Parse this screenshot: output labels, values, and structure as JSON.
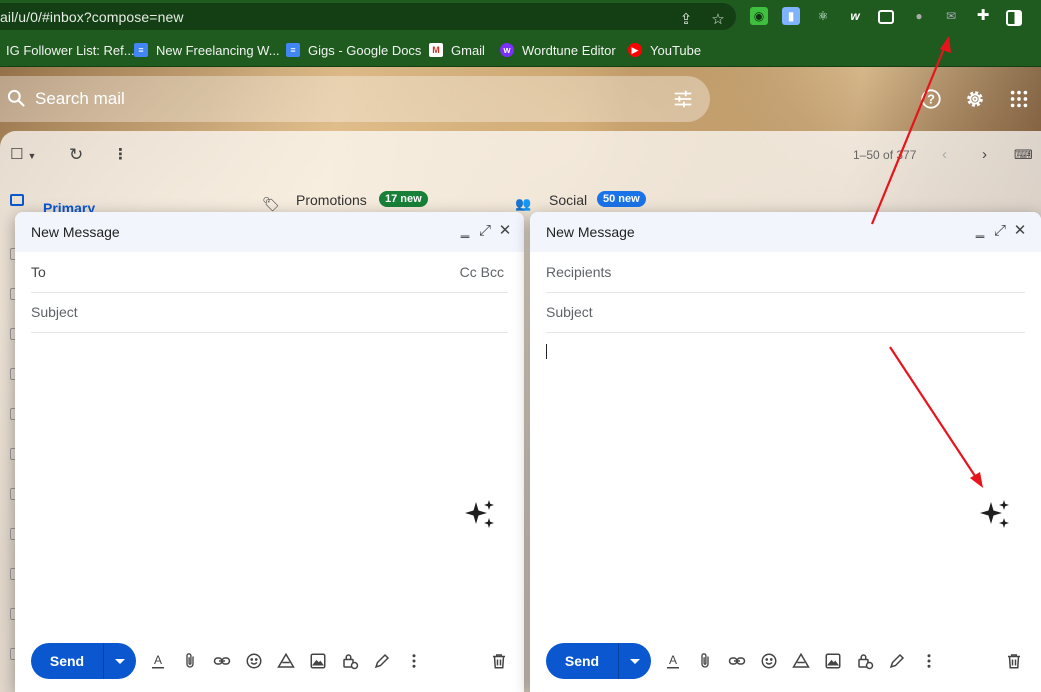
{
  "browser": {
    "url": "ail/u/0/#inbox?compose=new",
    "bookmarks": [
      {
        "label": "IG Follower List: Ref...",
        "icon": "globe-icon"
      },
      {
        "label": "New Freelancing W...",
        "icon": "docs-icon"
      },
      {
        "label": "Gigs - Google Docs",
        "icon": "docs-icon"
      },
      {
        "label": "Gmail",
        "icon": "gmail-icon"
      },
      {
        "label": "Wordtune Editor",
        "icon": "wordtune-icon"
      },
      {
        "label": "YouTube",
        "icon": "youtube-icon"
      }
    ]
  },
  "gmail": {
    "search_placeholder": "Search mail",
    "pagination": "1–50 of 377",
    "tabs": [
      {
        "label": "Primary"
      },
      {
        "label": "Promotions",
        "badge": "17 new",
        "badge_color": "#188038"
      },
      {
        "label": "Social",
        "badge": "50 new",
        "badge_color": "#1a73e8"
      }
    ]
  },
  "compose_left": {
    "title": "New Message",
    "to_label": "To",
    "cc_bcc": "Cc Bcc",
    "subject_placeholder": "Subject",
    "send_label": "Send"
  },
  "compose_right": {
    "title": "New Message",
    "recipients_placeholder": "Recipients",
    "subject_placeholder": "Subject",
    "send_label": "Send"
  },
  "colors": {
    "chrome_green": "#1f5a1f",
    "send_blue": "#0b57d0",
    "annotation_red": "#e8141c"
  }
}
